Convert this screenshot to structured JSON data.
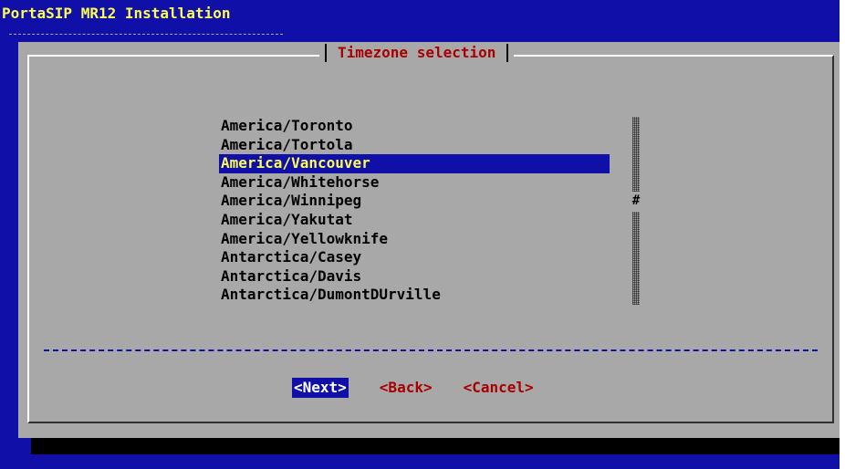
{
  "app": {
    "title": "PortaSIP MR12 Installation"
  },
  "dialog": {
    "title": "Timezone selection",
    "items": [
      "America/Toronto",
      "America/Tortola",
      "America/Vancouver",
      "America/Whitehorse",
      "America/Winnipeg",
      "America/Yakutat",
      "America/Yellowknife",
      "Antarctica/Casey",
      "Antarctica/Davis",
      "Antarctica/DumontDUrville"
    ],
    "selected_index": 2,
    "scrollbar": {
      "thumb_glyph": "#",
      "thumb_position": 0.4
    },
    "buttons": {
      "next": "<Next>",
      "back": "<Back>",
      "cancel": "<Cancel>"
    }
  },
  "colors": {
    "background": "#1010a8",
    "dialog": "#a8a8a8",
    "title_text": "#fcfc54",
    "dialog_title": "#a80000",
    "selection_bg": "#1010a8",
    "selection_text": "#fcfc54",
    "button_text": "#a80000",
    "active_button_text": "#ffffff"
  }
}
